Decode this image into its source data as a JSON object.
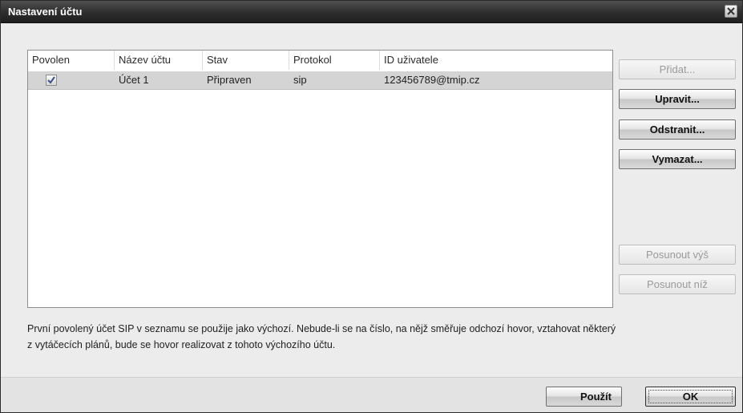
{
  "window": {
    "title": "Nastavení účtu",
    "close_icon": "close-icon"
  },
  "list": {
    "columns": [
      "Povolen",
      "Název účtu",
      "Stav",
      "Protokol",
      "ID uživatele"
    ],
    "rows": [
      {
        "enabled": true,
        "name": "Účet 1",
        "status": "Připraven",
        "protocol": "sip",
        "user_id": "123456789@tmip.cz"
      }
    ]
  },
  "buttons": {
    "add": "Přidat...",
    "edit": "Upravit...",
    "remove": "Odstranit...",
    "clear": "Vymazat...",
    "move_up": "Posunout výš",
    "move_down": "Posunout níž"
  },
  "info_text": "První povolený účet SIP v seznamu se použije jako výchozí. Nebude-li se na číslo, na nějž směřuje odchozí hovor, vztahovat některý z vytáčecích plánů, bude se hovor realizovat z tohoto výchozího účtu.",
  "footer": {
    "apply": "Použít",
    "ok": "OK"
  }
}
